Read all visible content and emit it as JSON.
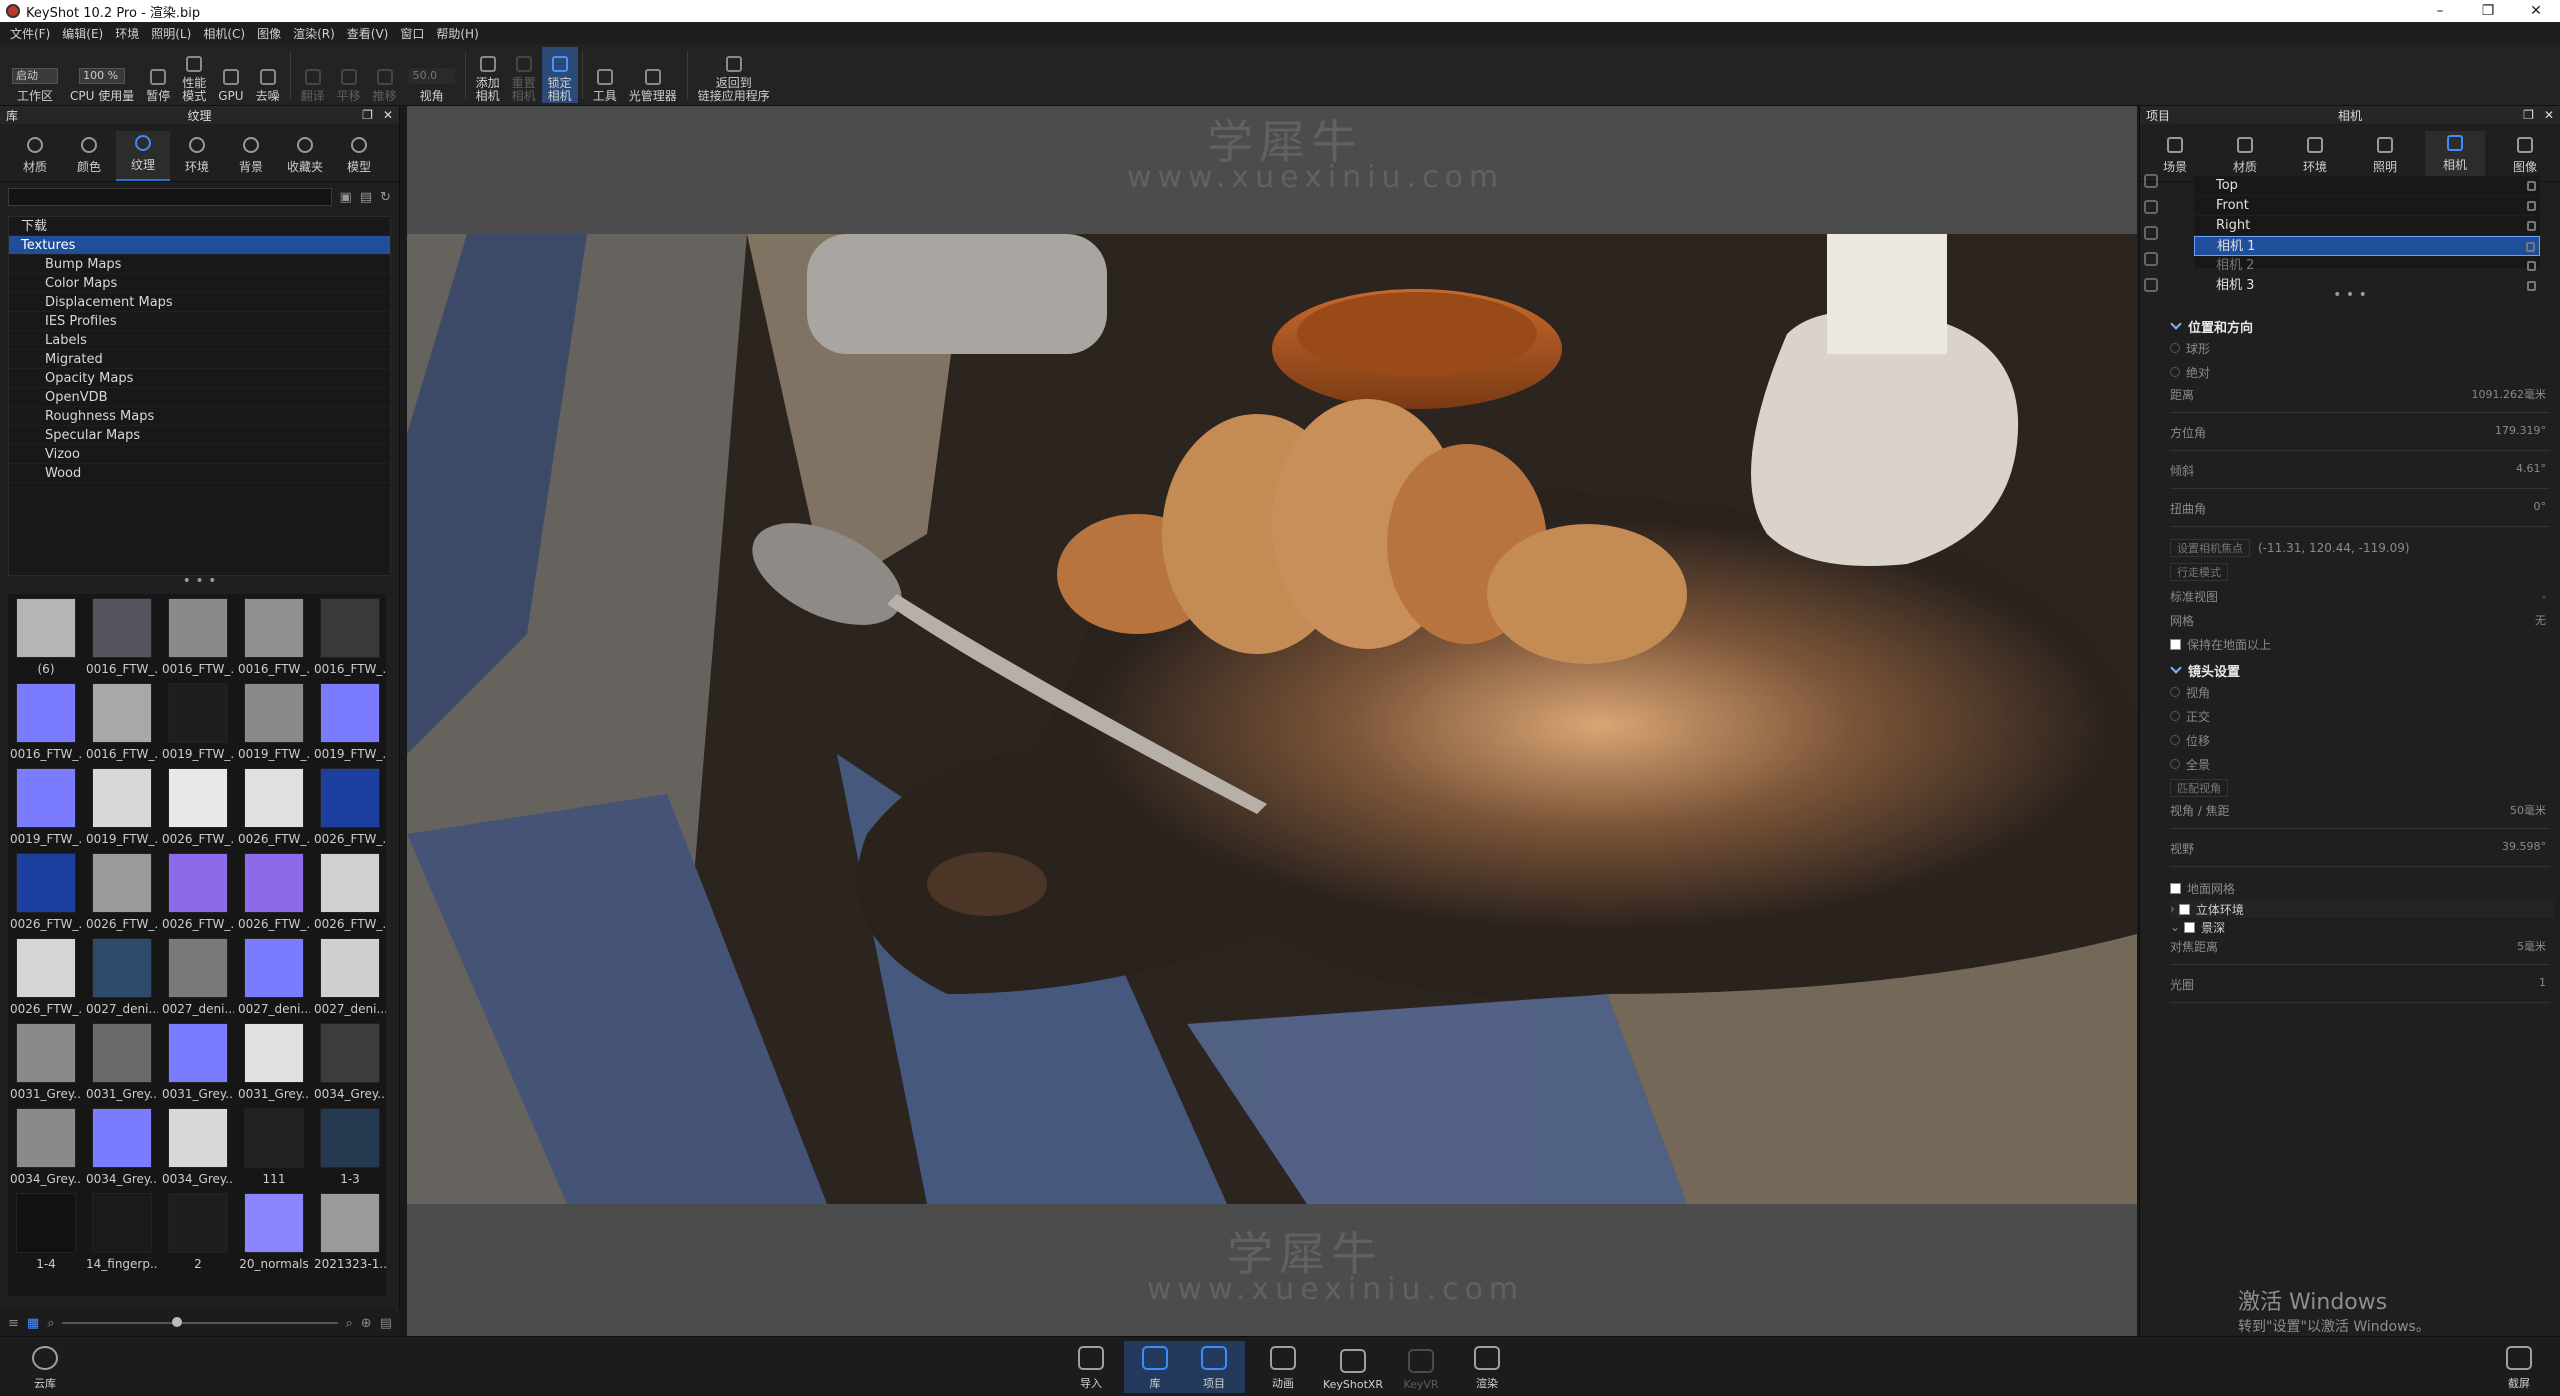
{
  "window": {
    "title": "KeyShot 10.2 Pro  - 渲染.bip"
  },
  "menu": [
    "文件(F)",
    "编辑(E)",
    "环境",
    "照明(L)",
    "相机(C)",
    "图像",
    "渲染(R)",
    "查看(V)",
    "窗口",
    "帮助(H)"
  ],
  "toolbar": {
    "workspace_value": "启动",
    "workspace_label": "工作区",
    "cpu_value": "100 %",
    "cpu_label": "CPU 使用量",
    "pause_label": "暂停",
    "perf_label": "性能\n模式",
    "gpu_label": "GPU",
    "denoise_label": "去噪",
    "flip_label": "翻译",
    "pan_label": "平移",
    "push_label": "推移",
    "fov_value": "50.0",
    "fov_label": "视角",
    "add_cam_label": "添加\n相机",
    "reset_cam_label": "重置\n相机",
    "lock_cam_label": "锁定\n相机",
    "tools_label": "工具",
    "light_mgr_label": "光管理器",
    "back_link_label": "返回到\n链接应用程序"
  },
  "left_panel": {
    "header_left": "库",
    "header_title": "纹理",
    "tabs": [
      "材质",
      "颜色",
      "纹理",
      "环境",
      "背景",
      "收藏夹",
      "模型"
    ],
    "active_tab": "纹理",
    "search_placeholder": "",
    "tree": {
      "root": "下载",
      "selected": "Textures",
      "children": [
        "Bump Maps",
        "Color Maps",
        "Displacement Maps",
        "IES Profiles",
        "Labels",
        "Migrated",
        "Opacity Maps",
        "OpenVDB",
        "Roughness Maps",
        "Specular Maps",
        "Vizoo",
        "Wood"
      ]
    },
    "thumbnails": [
      {
        "caption": "(6)",
        "color": "#b5b5b5"
      },
      {
        "caption": "0016_FTW_...",
        "color": "#55555f"
      },
      {
        "caption": "0016_FTW_...",
        "color": "#8a8a8a"
      },
      {
        "caption": "0016_FTW_...",
        "color": "#909090"
      },
      {
        "caption": "0016_FTW_...",
        "color": "#3a3a3a"
      },
      {
        "caption": "0016_FTW_...",
        "color": "#7b7bff"
      },
      {
        "caption": "0016_FTW_...",
        "color": "#a8a8a8"
      },
      {
        "caption": "0019_FTW_...",
        "color": "#1e1e1e"
      },
      {
        "caption": "0019_FTW_...",
        "color": "#8a8a8a"
      },
      {
        "caption": "0019_FTW_...",
        "color": "#7b7bff"
      },
      {
        "caption": "0019_FTW_...",
        "color": "#7b7bff"
      },
      {
        "caption": "0019_FTW_...",
        "color": "#d8d8d8"
      },
      {
        "caption": "0026_FTW_...",
        "color": "#e8e8e8"
      },
      {
        "caption": "0026_FTW_...",
        "color": "#e0e0e0"
      },
      {
        "caption": "0026_FTW_...",
        "color": "#1d3fa0"
      },
      {
        "caption": "0026_FTW_...",
        "color": "#1d3fa0"
      },
      {
        "caption": "0026_FTW_...",
        "color": "#9a9a9a"
      },
      {
        "caption": "0026_FTW_...",
        "color": "#8d6be8"
      },
      {
        "caption": "0026_FTW_...",
        "color": "#8d6be8"
      },
      {
        "caption": "0026_FTW_...",
        "color": "#d0d0d0"
      },
      {
        "caption": "0026_FTW_...",
        "color": "#d5d5d5"
      },
      {
        "caption": "0027_deni...",
        "color": "#2e4a6a"
      },
      {
        "caption": "0027_deni...",
        "color": "#7a7a7a"
      },
      {
        "caption": "0027_deni...",
        "color": "#7b7bff"
      },
      {
        "caption": "0027_deni...",
        "color": "#cfcfcf"
      },
      {
        "caption": "0031_Grey...",
        "color": "#8a8a8a"
      },
      {
        "caption": "0031_Grey...",
        "color": "#6a6a6a"
      },
      {
        "caption": "0031_Grey...",
        "color": "#7b7bff"
      },
      {
        "caption": "0031_Grey...",
        "color": "#e0e0e0"
      },
      {
        "caption": "0034_Grey...",
        "color": "#3c3c3c"
      },
      {
        "caption": "0034_Grey...",
        "color": "#8a8a8a"
      },
      {
        "caption": "0034_Grey...",
        "color": "#7b7bff"
      },
      {
        "caption": "0034_Grey...",
        "color": "#d8d8d8"
      },
      {
        "caption": "111",
        "color": "#222222"
      },
      {
        "caption": "1-3",
        "color": "#24384f"
      },
      {
        "caption": "1-4",
        "color": "#111111"
      },
      {
        "caption": "14_fingerp...",
        "color": "#1a1a1a"
      },
      {
        "caption": "2",
        "color": "#1e1e1e"
      },
      {
        "caption": "20_normals",
        "color": "#8a84ff"
      },
      {
        "caption": "2021323-1...",
        "color": "#9a9a9a"
      }
    ]
  },
  "right_panel": {
    "header_left": "项目",
    "header_title": "相机",
    "tabs": [
      "场景",
      "材质",
      "环境",
      "照明",
      "相机",
      "图像"
    ],
    "active_tab": "相机",
    "cameras": [
      {
        "name": "Top",
        "selected": false,
        "dim": false
      },
      {
        "name": "Front",
        "selected": false,
        "dim": false
      },
      {
        "name": "Right",
        "selected": false,
        "dim": false
      },
      {
        "name": "相机 1",
        "selected": true,
        "dim": false
      },
      {
        "name": "相机 2",
        "selected": false,
        "dim": true
      },
      {
        "name": "相机 3",
        "selected": false,
        "dim": false
      }
    ],
    "pos_section": "位置和方向",
    "radio_orbit": "球形",
    "radio_absolute": "绝对",
    "distance_label": "距离",
    "distance_value": "1091.262毫米",
    "azimuth_label": "方位角",
    "azimuth_value": "179.319°",
    "incl_label": "倾斜",
    "incl_value": "4.61°",
    "twist_label": "扭曲角",
    "twist_value": "0°",
    "set_focus_btn": "设置相机焦点",
    "focus_coords": "(-11.31, 120.44, -119.09)",
    "walk_mode_btn": "行走模式",
    "std_view_label": "标准视图",
    "std_view_value": "-",
    "grid_label": "网格",
    "grid_value": "无",
    "keep_above_label": "保持在地面以上",
    "lens_section": "镜头设置",
    "lens_opts": [
      "视角",
      "正交",
      "位移",
      "全景"
    ],
    "match_view_btn": "匹配视角",
    "fov_focal_label": "视角 / 焦距",
    "fov_focal_value": "50毫米",
    "fov_label": "视野",
    "fov_value": "39.598°",
    "ground_grid_label": "地面网格",
    "stereo_label": "立体环境",
    "dof_label": "景深",
    "focus_dist_label": "对焦距离",
    "focus_dist_value": "5毫米",
    "aperture_label": "光圈",
    "aperture_value": "1"
  },
  "watermark": {
    "cn": "学犀牛",
    "url": "www.xuexiniu.com"
  },
  "win_activation": {
    "line1": "激活 Windows",
    "line2": "转到\"设置\"以激活 Windows。"
  },
  "bottom_bar": {
    "cloud": "云库",
    "items": [
      {
        "label": "导入",
        "active": false,
        "dim": false
      },
      {
        "label": "库",
        "active": true,
        "dim": false
      },
      {
        "label": "项目",
        "active": true,
        "dim": false
      },
      {
        "label": "动画",
        "active": false,
        "dim": false
      },
      {
        "label": "KeyShotXR",
        "active": false,
        "dim": false
      },
      {
        "label": "KeyVR",
        "active": false,
        "dim": true
      },
      {
        "label": "渲染",
        "active": false,
        "dim": false
      }
    ],
    "screenshot": "截屏"
  }
}
